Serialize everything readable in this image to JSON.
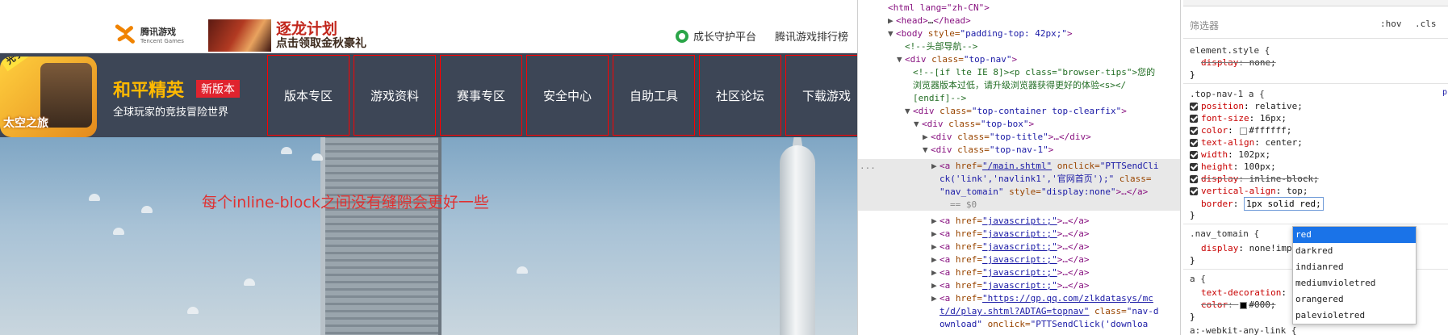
{
  "page": {
    "topbar": {
      "tencent_cn": "腾讯游戏",
      "tencent_en": "Tencent Games",
      "promo_title": "逐龙计划",
      "promo_sub": "点击领取金秋豪礼",
      "guard_label": "成长守护平台",
      "rank_label": "腾讯游戏排行榜"
    },
    "game": {
      "badge_corner": "光子",
      "badge_sub": "太空之旅",
      "name": "和平精英",
      "new_tag": "新版本",
      "slogan": "全球玩家的竞技冒险世界"
    },
    "nav": [
      {
        "label": "版本专区"
      },
      {
        "label": "游戏资料"
      },
      {
        "label": "赛事专区"
      },
      {
        "label": "安全中心"
      },
      {
        "label": "自助工具"
      },
      {
        "label": "社区论坛"
      },
      {
        "label": "下载游戏"
      }
    ],
    "annotation": "每个inline-block之间没有缝隙会更好一些"
  },
  "devtools": {
    "dom": {
      "l1": "<html lang=\"zh-CN\">",
      "l2_open": "<head>",
      "l2_ell": "…",
      "l2_close": "</head>",
      "l3_tag": "<body",
      "l3_attr": " style=",
      "l3_val": "\"padding-top: 42px;\"",
      "l3_end": ">",
      "l4": "<!--头部导航-->",
      "l5_tag": "<div",
      "l5_attr": " class=",
      "l5_val": "\"top-nav\"",
      "l5_end": ">",
      "l6a": "<!--[if lte IE 8]><p class=\"browser-tips\">您的",
      "l6b": "浏览器版本过低，请升级浏览器获得更好的体验<s></",
      "l6c": "[endif]-->",
      "l7_val": "\"top-container top-clearfix\"",
      "l8_val": "\"top-box\"",
      "l9_val": "\"top-title\"",
      "l9_tail": ">…</div>",
      "l10_val": "\"top-nav-1\"",
      "sel_a": "<a",
      "sel_href": " href=",
      "sel_href_val": "\"/main.shtml\"",
      "sel_onclick": " onclick=",
      "sel_onclick_val1": "\"PTTSendCli",
      "sel_onclick_val2": "ck('link','navlink1','官网首页');\"",
      "sel_class": " class=",
      "sel_class_val": "\"nav_tomain\"",
      "sel_style": " style=",
      "sel_style_val": "\"display:none\"",
      "sel_tail": ">…</a>",
      "sel_eq": "== $0",
      "js_href": "\"javascript:;\"",
      "js_tail": ">…</a>",
      "dl_href1": "\"https://gp.qq.com/zlkdatasys/mc",
      "dl_href2": "t/d/play.shtml?ADTAG=topnav\"",
      "dl_class": " class=",
      "dl_class_val": "\"nav-d",
      "dl_l3a": "ownload\"",
      "dl_l3b": " onclick=",
      "dl_l3c": "\"PTTSendClick('downloa"
    },
    "styles": {
      "filter_placeholder": "筛选器",
      "hov": ":hov",
      "cls": ".cls",
      "element_style": "element.style {",
      "es_prop": "display",
      "es_val": "none;",
      "rule1_sel": ".top-nav-1 a {",
      "rule1_src": "p",
      "r1": [
        {
          "prop": "position",
          "val": "relative;",
          "struck": false
        },
        {
          "prop": "font-size",
          "val": "16px;",
          "struck": false
        },
        {
          "prop": "color",
          "val": "#ffffff;",
          "struck": false,
          "swatch": "#ffffff"
        },
        {
          "prop": "text-align",
          "val": "center;",
          "struck": false
        },
        {
          "prop": "width",
          "val": "102px;",
          "struck": false
        },
        {
          "prop": "height",
          "val": "100px;",
          "struck": false
        },
        {
          "prop": "display",
          "val": "inline-block;",
          "struck": true
        },
        {
          "prop": "vertical-align",
          "val": "top;",
          "struck": false
        }
      ],
      "border_prop": "border",
      "border_val": "1px solid red;",
      "rule2_sel": ".nav_tomain {",
      "rule2_prop": "display",
      "rule2_val": "none!impo",
      "rule3_sel": "a {",
      "rule3_p1": "text-decoration",
      "rule3_p2": "color",
      "rule3_v2": "#000;",
      "rule4_sel": "a:-webkit-any-link {",
      "brace": "}"
    },
    "autocomplete": [
      "red",
      "darkred",
      "indianred",
      "mediumvioletred",
      "orangered",
      "palevioletred"
    ]
  }
}
